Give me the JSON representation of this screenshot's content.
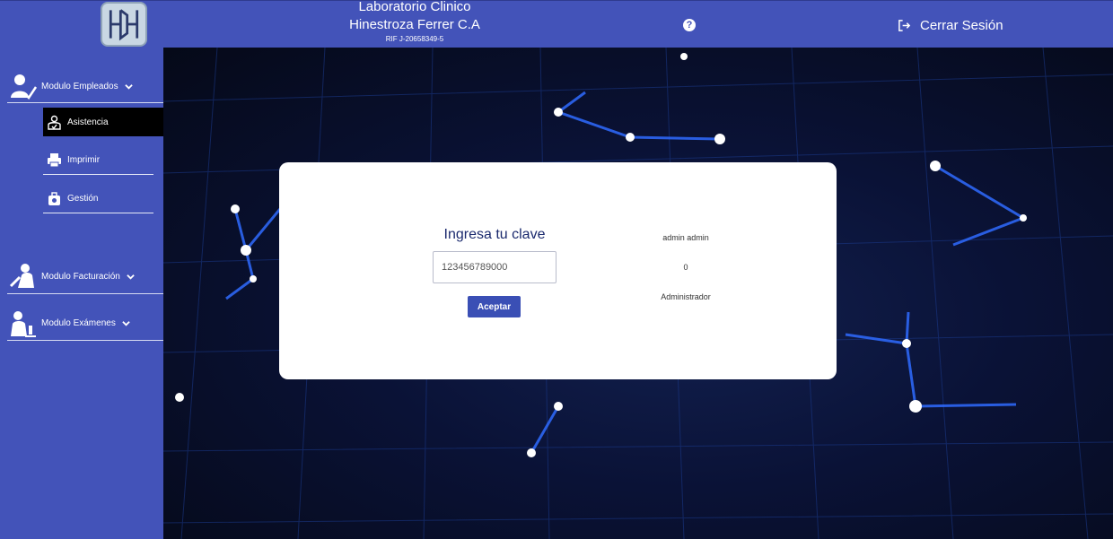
{
  "header": {
    "lab_line1": "Laboratorio Clinico",
    "lab_line2": "Hinestroza Ferrer C.A",
    "rif": "RIF J-20658349-5",
    "help_label": "?",
    "logout_label": "Cerrar Sesión"
  },
  "sidebar": {
    "modules": [
      {
        "label": "Modulo Empleados",
        "icon": "employee-icon"
      },
      {
        "label": "Modulo Facturación",
        "icon": "billing-icon"
      },
      {
        "label": "Modulo Exámenes",
        "icon": "lab-exam-icon"
      }
    ],
    "submenu": [
      {
        "label": "Asistencia",
        "icon": "attendance-icon",
        "active": true
      },
      {
        "label": "Imprimir",
        "icon": "printer-icon",
        "active": false
      },
      {
        "label": "Gestión",
        "icon": "management-icon",
        "active": false
      }
    ]
  },
  "dialog": {
    "title": "Ingresa tu clave",
    "password_value": "123456789000",
    "accept_label": "Aceptar",
    "user_name": "admin admin",
    "user_code": "0",
    "user_role": "Administrador"
  },
  "colors": {
    "primary": "#4353b9",
    "active_item": "#000000",
    "button": "#3a4fb5",
    "title_text": "#1b2a6e"
  }
}
